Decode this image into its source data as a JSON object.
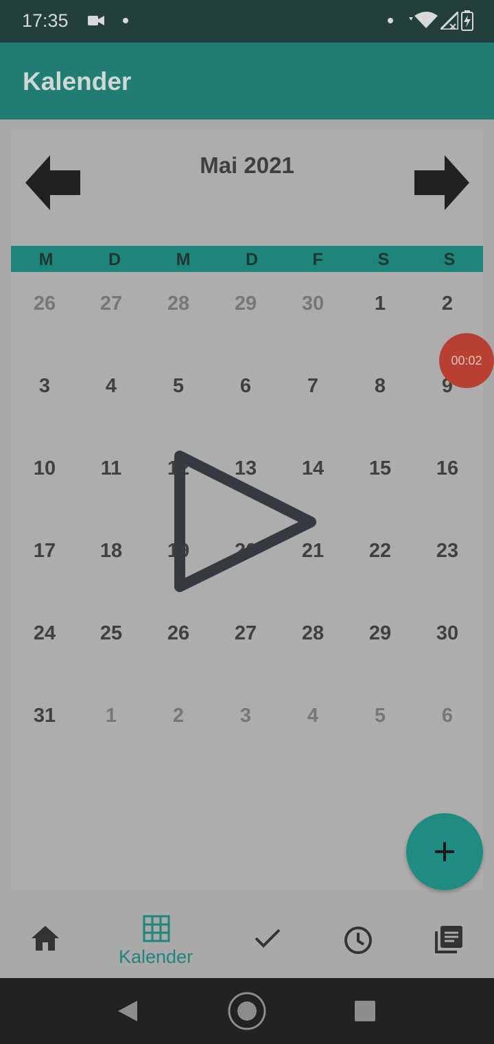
{
  "status_bar": {
    "time": "17:35"
  },
  "app_bar": {
    "title": "Kalender"
  },
  "calendar": {
    "month_label": "Mai 2021",
    "weekdays": [
      "M",
      "D",
      "M",
      "D",
      "F",
      "S",
      "S"
    ],
    "weeks": [
      [
        {
          "d": "26",
          "m": true
        },
        {
          "d": "27",
          "m": true
        },
        {
          "d": "28",
          "m": true
        },
        {
          "d": "29",
          "m": true
        },
        {
          "d": "30",
          "m": true
        },
        {
          "d": "1"
        },
        {
          "d": "2"
        }
      ],
      [
        {
          "d": "3"
        },
        {
          "d": "4"
        },
        {
          "d": "5"
        },
        {
          "d": "6"
        },
        {
          "d": "7"
        },
        {
          "d": "8"
        },
        {
          "d": "9"
        }
      ],
      [
        {
          "d": "10"
        },
        {
          "d": "11"
        },
        {
          "d": "12"
        },
        {
          "d": "13"
        },
        {
          "d": "14"
        },
        {
          "d": "15"
        },
        {
          "d": "16"
        }
      ],
      [
        {
          "d": "17"
        },
        {
          "d": "18"
        },
        {
          "d": "19"
        },
        {
          "d": "20"
        },
        {
          "d": "21"
        },
        {
          "d": "22"
        },
        {
          "d": "23"
        }
      ],
      [
        {
          "d": "24"
        },
        {
          "d": "25"
        },
        {
          "d": "26"
        },
        {
          "d": "27"
        },
        {
          "d": "28"
        },
        {
          "d": "29"
        },
        {
          "d": "30"
        }
      ],
      [
        {
          "d": "31"
        },
        {
          "d": "1",
          "m": true
        },
        {
          "d": "2",
          "m": true
        },
        {
          "d": "3",
          "m": true
        },
        {
          "d": "4",
          "m": true
        },
        {
          "d": "5",
          "m": true
        },
        {
          "d": "6",
          "m": true
        }
      ]
    ]
  },
  "recording_badge": {
    "time": "00:02"
  },
  "fab": {
    "icon": "plus-icon"
  },
  "bottom_nav": {
    "items": [
      {
        "icon": "home-icon"
      },
      {
        "icon": "calendar-grid-icon",
        "label": "Kalender",
        "active": true
      },
      {
        "icon": "check-icon"
      },
      {
        "icon": "clock-icon"
      },
      {
        "icon": "notes-icon"
      }
    ]
  },
  "colors": {
    "accent": "#1f857b",
    "app_bar": "#217d73",
    "status_bar": "#233f3b",
    "record": "#b84032"
  }
}
